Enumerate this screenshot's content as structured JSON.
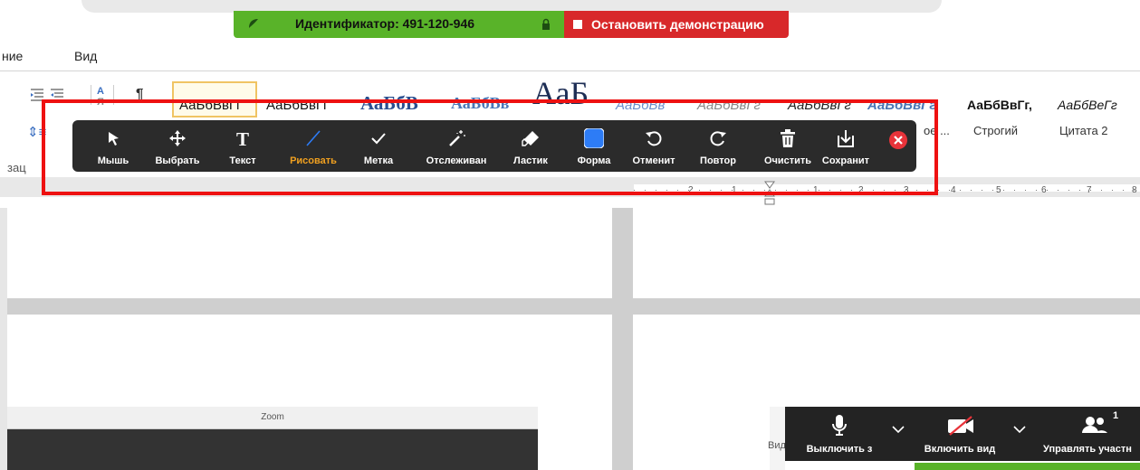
{
  "share_bar": {
    "identifier": "Идентификатор: 491-120-946",
    "stop_label": "Остановить демонстрацию",
    "green": "#59b329",
    "red": "#d8282a"
  },
  "menu": {
    "item_partial": "ние",
    "view": "Вид"
  },
  "styles": {
    "previews": [
      "АаБбВвГг",
      "АаБбВвГг",
      "АаБбВ",
      "АаБбВв",
      "АаБ",
      "АаБбВв",
      "АаБбВвГг",
      "АаБбВвГг",
      "АаБбВвГг",
      "АаБбВвГг,",
      "АаБбВеГг"
    ],
    "names": [
      "ое ...",
      "Строгий",
      "Цитата 2"
    ]
  },
  "ribbon": {
    "paragraph_label": "зац"
  },
  "ruler": {
    "numbers": [
      "2",
      "1",
      "1",
      "2",
      "3",
      "4",
      "5",
      "6",
      "7",
      "8"
    ]
  },
  "annotation_toolbar": {
    "tools": [
      {
        "label": "Мышь",
        "icon": "arrow-cursor-icon"
      },
      {
        "label": "Выбрать",
        "icon": "move-icon"
      },
      {
        "label": "Текст",
        "icon": "text-icon"
      },
      {
        "label": "Рисовать",
        "icon": "pen-line-icon",
        "active": true
      },
      {
        "label": "Метка",
        "icon": "checkmark-icon"
      },
      {
        "label": "Отслеживан",
        "icon": "magic-wand-icon"
      },
      {
        "label": "Ластик",
        "icon": "eraser-icon"
      },
      {
        "label": "Форма",
        "icon": "shape-square-icon"
      },
      {
        "label": "Отменит",
        "icon": "undo-icon"
      },
      {
        "label": "Повтор",
        "icon": "redo-icon"
      },
      {
        "label": "Очистить",
        "icon": "trash-icon"
      },
      {
        "label": "Сохранит",
        "icon": "save-download-icon"
      }
    ],
    "active_color": "#f0a020",
    "shape_color": "#2d7cf6",
    "close_color": "#e8333a"
  },
  "zoom_window": {
    "title": "Zoom"
  },
  "side_text": "Вид",
  "meeting_controls": {
    "mute": "Выключить з",
    "video": "Включить вид",
    "participants": "Управлять участн",
    "participants_count": "1"
  }
}
